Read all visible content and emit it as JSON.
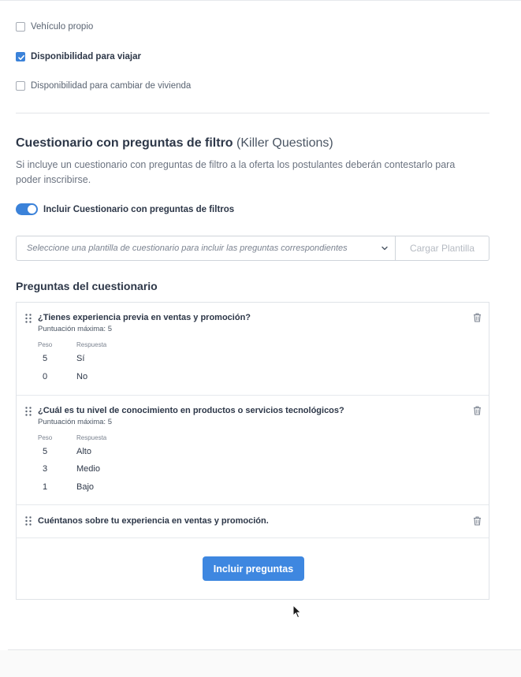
{
  "requirements": {
    "vehicle": {
      "label": "Vehículo propio",
      "checked": false
    },
    "travel": {
      "label": "Disponibilidad para viajar",
      "checked": true
    },
    "relocation": {
      "label": "Disponibilidad para cambiar de vivienda",
      "checked": false
    }
  },
  "killer": {
    "title": "Cuestionario con preguntas de filtro",
    "title_suffix": "(Killer Questions)",
    "description": "Si incluye un cuestionario con preguntas de filtro a la oferta los postulantes deberán contestarlo para poder inscribirse.",
    "toggle_label": "Incluir Cuestionario con preguntas de filtros",
    "toggle_on": true,
    "template_placeholder": "Seleccione una plantilla de cuestionario para incluir las preguntas correspondientes",
    "load_button": "Cargar Plantilla"
  },
  "questionnaire": {
    "title": "Preguntas del cuestionario",
    "weight_header": "Peso",
    "answer_header": "Respuesta",
    "questions": [
      {
        "title": "¿Tienes experiencia previa en ventas y promoción?",
        "max_score": "Puntuación máxima: 5",
        "answers": [
          {
            "weight": "5",
            "answer": "Sí"
          },
          {
            "weight": "0",
            "answer": "No"
          }
        ]
      },
      {
        "title": "¿Cuál es tu nivel de conocimiento en productos o servicios tecnológicos?",
        "max_score": "Puntuación máxima: 5",
        "answers": [
          {
            "weight": "5",
            "answer": "Alto"
          },
          {
            "weight": "3",
            "answer": "Medio"
          },
          {
            "weight": "1",
            "answer": "Bajo"
          }
        ]
      },
      {
        "title": "Cuéntanos sobre tu experiencia en ventas y promoción."
      }
    ],
    "include_button": "Incluir preguntas"
  },
  "colors": {
    "accent": "#3b82d9",
    "button": "#3e87e0"
  }
}
